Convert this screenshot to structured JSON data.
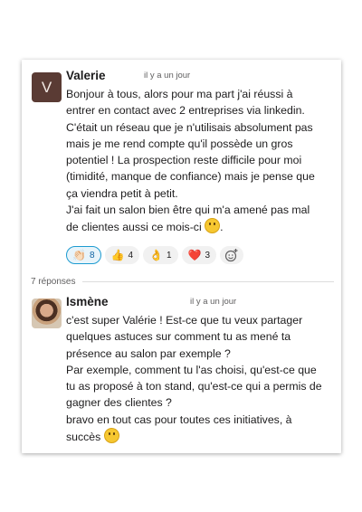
{
  "messages": [
    {
      "author": "Valerie",
      "avatar_letter": "V",
      "timestamp": "il y a un jour",
      "lines": [
        "Bonjour à tous, alors pour ma part j'ai réussi à",
        "entrer en contact avec 2 entreprises via linkedin.",
        "C'était un réseau que je n'utilisais absolument pas",
        "mais je me rend compte qu'il possède un gros",
        "potentiel ! La prospection reste difficile pour moi",
        "(timidité, manque de confiance) mais je pense que",
        "ça viendra petit à petit.",
        "J'ai fait un salon bien être qui m'a amené pas mal",
        "de clientes aussi ce mois-ci"
      ],
      "reactions": [
        {
          "icon": "👏🏻",
          "count": "8",
          "active": true
        },
        {
          "icon": "👍",
          "count": "4",
          "active": false
        },
        {
          "icon": "👌",
          "count": "1",
          "active": false
        },
        {
          "icon": "❤️",
          "count": "3",
          "active": false
        }
      ]
    },
    {
      "author": "Ismène",
      "timestamp": "il y a un jour",
      "lines": [
        "c'est super Valérie ! Est-ce que tu veux partager",
        "quelques astuces sur comment tu as mené ta",
        "présence au salon par exemple ?",
        "Par exemple, comment tu l'as choisi, qu'est-ce que",
        "tu as proposé à ton stand, qu'est-ce qui a permis de",
        "gagner des clientes ?",
        "bravo en tout cas pour toutes ces initiatives, à",
        "succès"
      ]
    }
  ],
  "replies_label": "7 réponses",
  "add_reaction_icon": "add-reaction-icon"
}
